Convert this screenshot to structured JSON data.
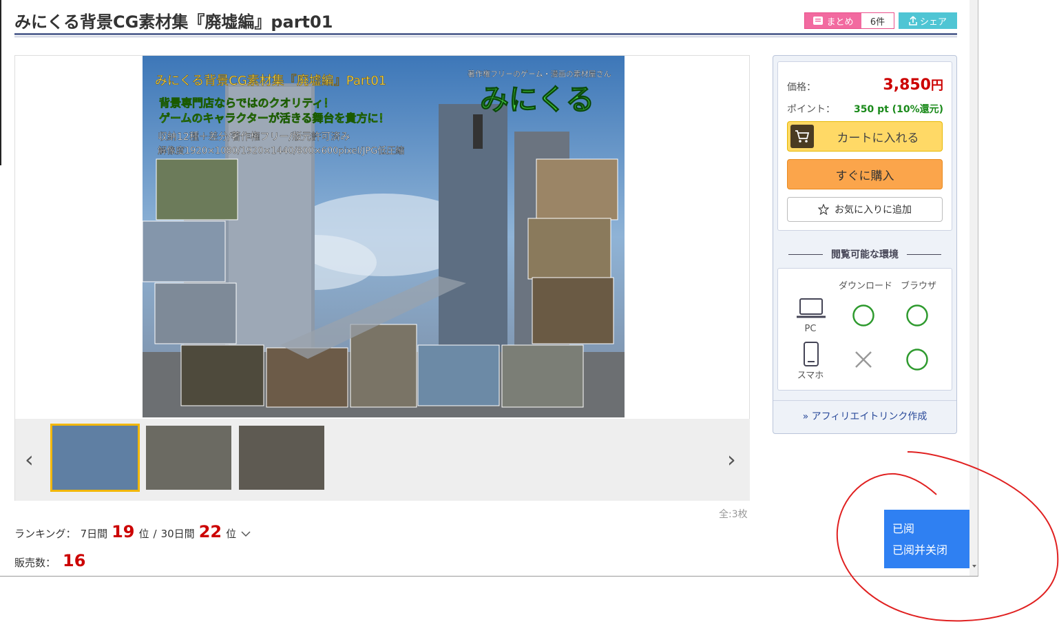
{
  "page": {
    "breadcrumb": "",
    "title": "みにくる背景CG素材集『廃墟編』part01"
  },
  "header_actions": {
    "matome_label": "まとめ",
    "matome_count": "6件",
    "share_label": "シェア"
  },
  "gallery": {
    "banner": {
      "title": "みにくる背景CG素材集『廃墟編』Part01",
      "tagline1": "背景専門店ならではのクオリティ！",
      "tagline2": "ゲームのキャラクターが活きる舞台を貴方に！",
      "spec1": "収納12種＋差分/著作権フリー/版元許可済み",
      "spec2": "解像度1920×1080/1920×1440/800×600pixel/JPG低圧縮",
      "brand_sub": "著作権フリーのゲーム・漫画の素材屋さん",
      "brand": "みにくる"
    },
    "total": "全:3枚"
  },
  "ranking": {
    "label": "ランキング：",
    "p7_label": "7日間",
    "p7_rank": "19",
    "pos1": "位",
    "sep": "/",
    "p30_label": "30日間",
    "p30_rank": "22",
    "pos2": "位"
  },
  "sales": {
    "label": "販売数：",
    "value": "16"
  },
  "purchase": {
    "price_label": "価格：",
    "price": "3,850",
    "price_unit": "円",
    "point_label": "ポイント：",
    "point_value": "350 pt (10%還元)",
    "cart_label": "カートに入れる",
    "buy_label": "すぐに購入",
    "fav_label": "お気に入りに追加"
  },
  "environment": {
    "title": "閲覧可能な環境",
    "col_download": "ダウンロード",
    "col_browser": "ブラウザ",
    "row_pc": "PC",
    "row_phone": "スマホ",
    "affiliate": "アフィリエイトリンク作成"
  },
  "popup": {
    "read": "已阅",
    "read_close": "已阅并关闭"
  },
  "colors": {
    "accent_red": "#cc0000",
    "cart_yellow": "#ffd966",
    "buy_orange": "#fba54b",
    "popup_blue": "#2f80f2",
    "ok_green": "#2e9a2e",
    "annotation_red": "#e02020"
  }
}
